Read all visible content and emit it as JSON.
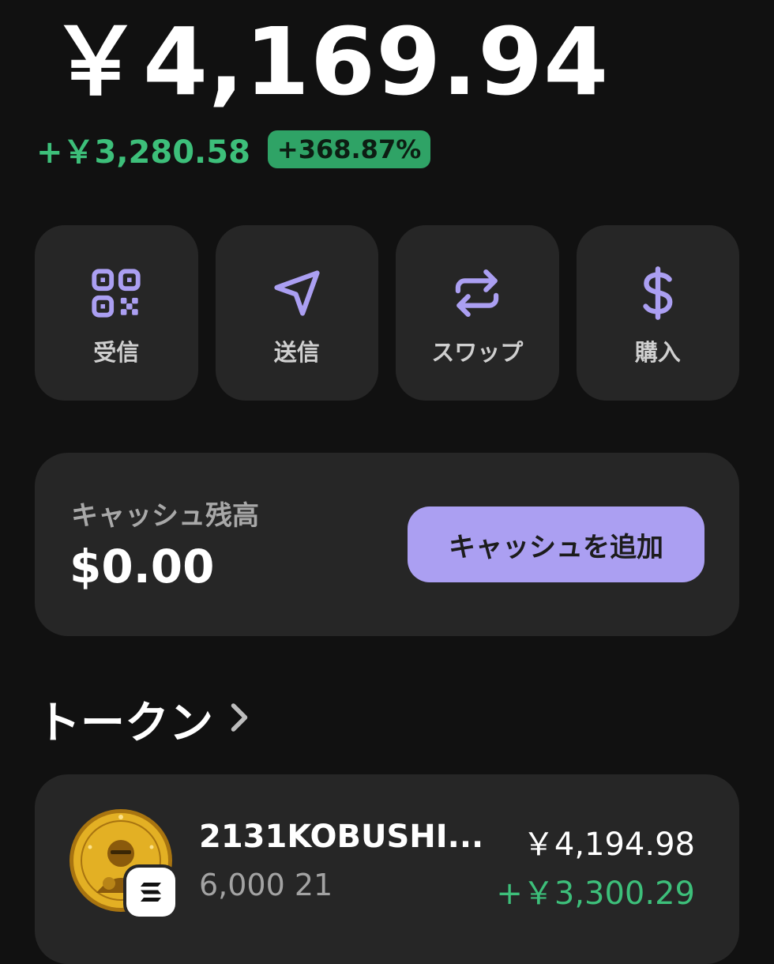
{
  "wallet": {
    "balance": "￥4,169.94",
    "change_amount": "+￥3,280.58",
    "change_percent": "+368.87%",
    "positive_color": "#3dbf7a"
  },
  "actions": [
    {
      "label": "受信",
      "icon": "qr-code-icon"
    },
    {
      "label": "送信",
      "icon": "send-icon"
    },
    {
      "label": "スワップ",
      "icon": "swap-icon"
    },
    {
      "label": "購入",
      "icon": "dollar-icon"
    }
  ],
  "accent_color": "#ab9ff2",
  "cash": {
    "title": "キャッシュ残高",
    "value": "$0.00",
    "button_label": "キャッシュを追加"
  },
  "tokens": {
    "section_title": "トークン",
    "chevron_icon": "chevron-right-icon",
    "items": [
      {
        "name": "2131KOBUSHI...",
        "amount": "6,000 21",
        "value": "￥4,194.98",
        "change": "+￥3,300.29",
        "logo_icon": "gold-coin-logo",
        "chain_icon": "solana-icon"
      }
    ]
  }
}
